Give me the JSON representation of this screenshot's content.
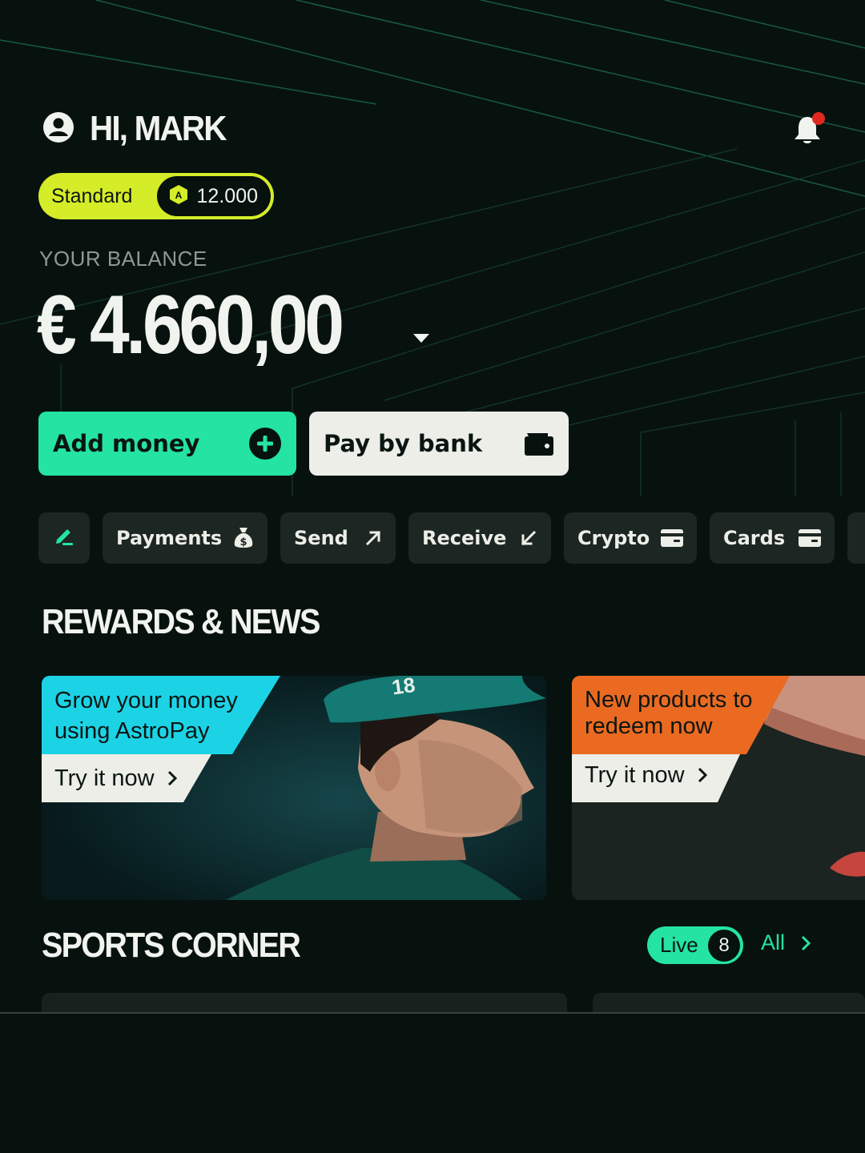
{
  "header": {
    "greeting": "HI, MARK"
  },
  "tier": {
    "name": "Standard",
    "points": "12.000",
    "badge_letter": "A"
  },
  "balance": {
    "label": "YOUR BALANCE",
    "amount": "€ 4.660,00"
  },
  "actions": {
    "add_money": "Add money",
    "pay_by_bank": "Pay by bank"
  },
  "quick_actions": [
    {
      "label": "",
      "icon": "pencil-icon"
    },
    {
      "label": "Payments",
      "icon": "money-bag-icon"
    },
    {
      "label": "Send",
      "icon": "arrow-up-right-icon"
    },
    {
      "label": "Receive",
      "icon": "arrow-down-left-icon"
    },
    {
      "label": "Crypto",
      "icon": "card-icon"
    },
    {
      "label": "Cards",
      "icon": "card-icon"
    }
  ],
  "rewards": {
    "title": "REWARDS & NEWS",
    "promos": [
      {
        "title_line1": "Grow your money",
        "title_line2": "using AstroPay",
        "cta": "Try it now",
        "cap_text": "18"
      },
      {
        "title_line1": "New products to",
        "title_line2": "redeem now",
        "cta": "Try it now"
      }
    ]
  },
  "sports": {
    "title": "SPORTS CORNER",
    "live_label": "Live",
    "live_count": "8",
    "all_label": "All"
  },
  "colors": {
    "background": "#07120f",
    "accent_green": "#24e3a3",
    "tier_yellow": "#d5ec28",
    "promo_cyan": "#1cd3e6",
    "promo_orange": "#ea6a21",
    "notification_red": "#e0281e"
  }
}
